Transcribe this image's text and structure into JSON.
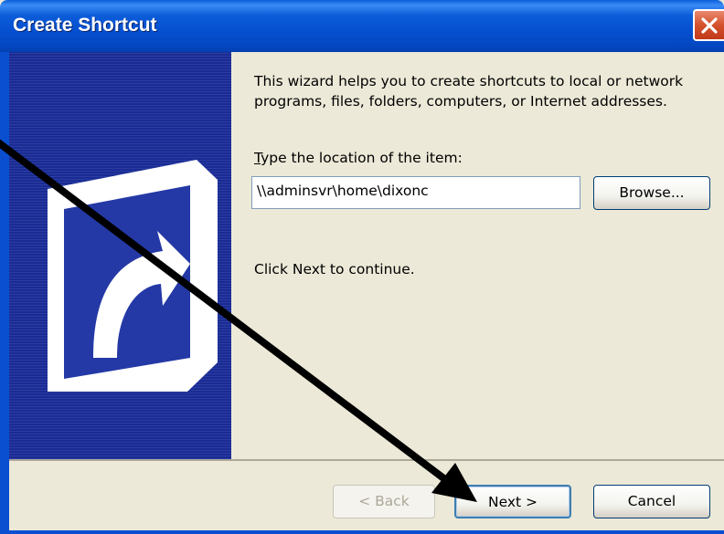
{
  "window": {
    "title": "Create Shortcut"
  },
  "wizard": {
    "intro_text": "This wizard helps you to create shortcuts to local or network programs, files, folders, computers, or Internet addresses.",
    "location_label_accel": "T",
    "location_label_rest": "ype the location of the item:",
    "location_value": "\\\\adminsvr\\home\\dixonc",
    "browse_label": "Browse...",
    "continue_text": "Click Next to continue."
  },
  "footer": {
    "back_label": "< Back",
    "next_label": "Next >",
    "cancel_label": "Cancel"
  },
  "icons": {
    "close": "close-icon",
    "shortcut_graphic": "shortcut-arrow-icon",
    "annotation_arrow": "pointer-arrow-annotation"
  },
  "colors": {
    "titlebar": "#0550D0",
    "side_panel": "#1A2C92",
    "dialog_bg": "#ECE9D8",
    "close_button": "#D4512D"
  }
}
